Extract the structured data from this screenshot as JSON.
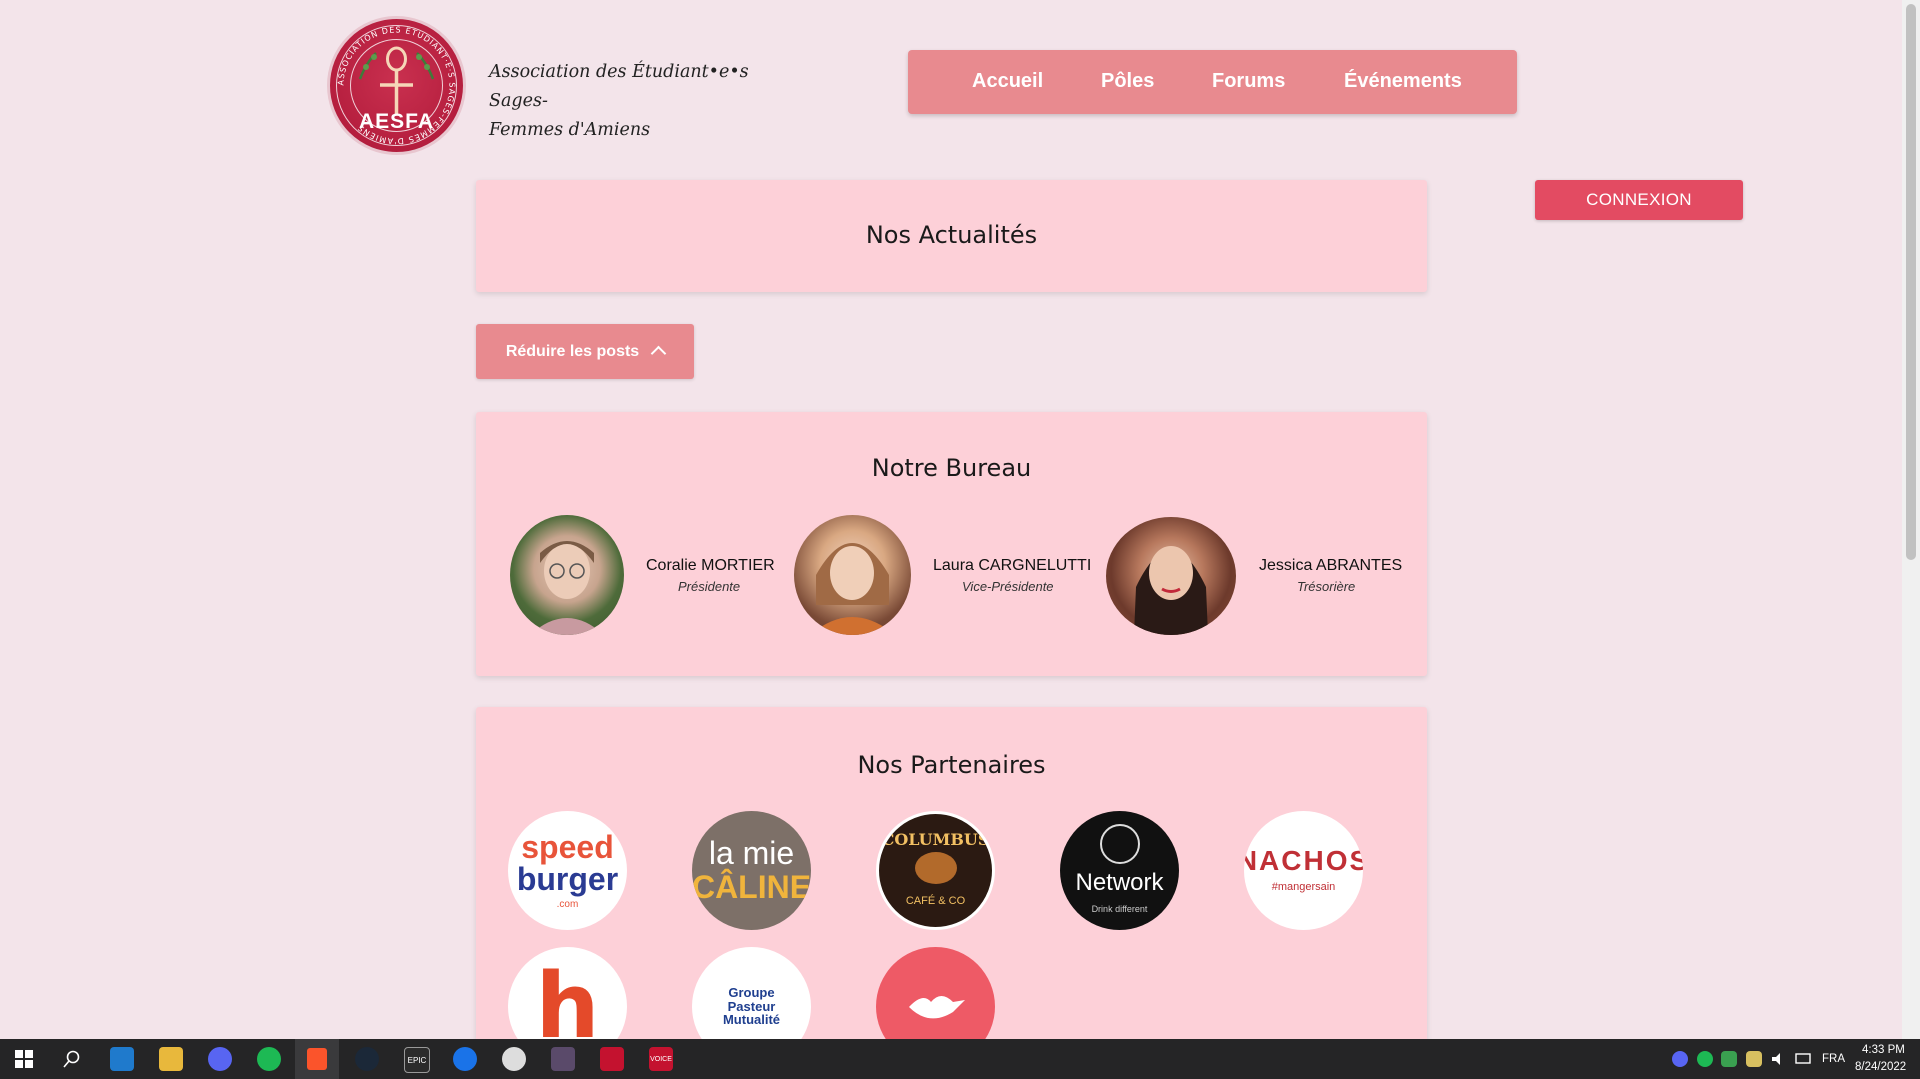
{
  "header": {
    "logo_text": "AESFA",
    "logo_ring_text": "ASSOCIATION DES ÉTUDIANT·E·S SAGES-FEMMES D'AMIENS",
    "site_title_line1": "Association des Étudiant•e•s Sages-",
    "site_title_line2": "Femmes d'Amiens"
  },
  "nav": {
    "items": [
      "Accueil",
      "Pôles",
      "Forums",
      "Événements"
    ]
  },
  "login_label": "CONNEXION",
  "news": {
    "title": "Nos Actualités"
  },
  "reduce_label": "Réduire les posts",
  "bureau": {
    "title": "Notre Bureau",
    "members": [
      {
        "name": "Coralie MORTIER",
        "role": "Présidente"
      },
      {
        "name": "Laura CARGNELUTTI",
        "role": "Vice-Présidente"
      },
      {
        "name": "Jessica ABRANTES",
        "role": "Trésorière"
      }
    ]
  },
  "partners": {
    "title": "Nos Partenaires",
    "logos": [
      {
        "line1": "speed",
        "line2": "burger",
        "line3": ".com"
      },
      {
        "line1": "la mie",
        "line2": "CÂLINE"
      },
      {
        "line1": "COLUMBUS",
        "line2": "CAFÉ & CO"
      },
      {
        "line1": "Network",
        "line2": "Drink different"
      },
      {
        "line1": "NACHOS",
        "line2": "#mangersain"
      },
      {
        "line1": "h"
      },
      {
        "line1": "Groupe",
        "line2": "Pasteur",
        "line3": "Mutualité"
      },
      {
        "line1": ""
      }
    ]
  },
  "taskbar": {
    "time": "4:33 PM",
    "date": "8/24/2022",
    "lang": "FRA",
    "epic_label": "EPIC",
    "voice_label": "VOICE"
  },
  "colors": {
    "background": "#f3e4ea",
    "card": "#fdd0d8",
    "nav": "#e88a8f",
    "login": "#e34b62",
    "taskbar": "#252526"
  }
}
